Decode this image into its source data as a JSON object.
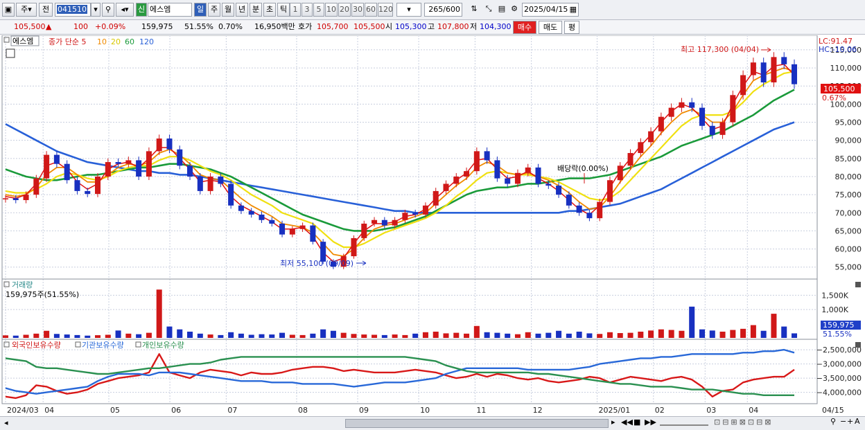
{
  "toolbar": {
    "type_label": "주",
    "prev_label": "전",
    "code": "041510",
    "badge": "신",
    "name": "에스엠",
    "periods": [
      "일",
      "주",
      "월",
      "년",
      "분",
      "초",
      "틱"
    ],
    "active_period": "일",
    "minutes": [
      "1",
      "3",
      "5",
      "10",
      "20",
      "30",
      "60",
      "120"
    ],
    "count": "265",
    "count_total": "/600",
    "date": "2025/04/15"
  },
  "quote": {
    "price": "105,500",
    "change": "100",
    "change_pct": "+0.09%",
    "volume": "159,975",
    "volume_ratio": "51.55%",
    "turnover": "0.70%",
    "amount": "16,950백만",
    "bid_label": "호가",
    "ask_price": "105,700",
    "bid_price": "105,500",
    "open_label": "시",
    "open": "105,300",
    "high_label": "고",
    "high": "107,800",
    "low_label": "저",
    "low": "104,300",
    "buy_button": "매수",
    "sell_button": "매도",
    "eval_button": "평"
  },
  "price_panel": {
    "name_tag": "에스엠",
    "ma_prefix": "종가 단순 5",
    "ma_periods": [
      "10",
      "20",
      "60",
      "120"
    ],
    "lc": "LC:91.47",
    "hc": "HC:-10.06",
    "current_tag": "105,500",
    "current_pct": "0.67%",
    "high_annotation": "최고 117,300 (04/04)",
    "low_annotation": "최저 55,100 (09/09)",
    "dividend_annotation": "배당락(0.00%)"
  },
  "volume_panel": {
    "title": "거래량",
    "info": "159,975주(51.55%)",
    "current_tag": "159,975",
    "current_pct": "51.55%"
  },
  "holdings_panel": {
    "series_labels": [
      "외국인보유수량",
      "기관보유수량",
      "개인보유수량"
    ]
  },
  "colors": {
    "up": "#d01818",
    "down": "#1830c0",
    "ma5": "#e01010",
    "ma10": "#f08a00",
    "ma20": "#f0e010",
    "ma60": "#1a9a3a",
    "ma120": "#2860d8",
    "foreign": "#d81818",
    "institution": "#2868d8",
    "individual": "#2a9050",
    "grid": "#c8cede",
    "axis_text": "#222222"
  },
  "chart_data": [
    {
      "type": "candlestick",
      "title": "에스엠",
      "x_axis_labels": [
        "2024/03",
        "04",
        "05",
        "06",
        "07",
        "08",
        "09",
        "10",
        "11",
        "12",
        "2025/01",
        "02",
        "03",
        "04",
        "04/15"
      ],
      "y_ticks": [
        55000,
        60000,
        65000,
        70000,
        75000,
        80000,
        85000,
        90000,
        95000,
        100000,
        105000,
        110000,
        115000
      ],
      "ylim": [
        51700,
        119000
      ],
      "series": [
        {
          "name": "종가",
          "values": [
            74000,
            73500,
            75000,
            79500,
            86000,
            83500,
            79000,
            76000,
            75200,
            80000,
            84000,
            83500,
            84500,
            80000,
            87000,
            90500,
            87500,
            83000,
            80000,
            76000,
            80000,
            78000,
            72000,
            70500,
            69500,
            68000,
            67000,
            64000,
            65500,
            66500,
            62000,
            56500,
            55100,
            58000,
            63000,
            67000,
            68000,
            66500,
            68000,
            70000,
            69500,
            72000,
            76000,
            78000,
            80000,
            81500,
            87000,
            84500,
            79500,
            78000,
            81000,
            82500,
            78000,
            77500,
            75000,
            72000,
            70000,
            68500,
            73000,
            79000,
            83000,
            86500,
            89500,
            92500,
            96500,
            99000,
            100500,
            99000,
            94000,
            91500,
            95000,
            102500,
            108000,
            111500,
            106000,
            113000,
            111000,
            105500
          ]
        },
        {
          "name": "5",
          "values": [
            74500,
            74000,
            75000,
            78000,
            83000,
            84000,
            82000,
            78500,
            76500,
            78000,
            82000,
            83500,
            84000,
            82500,
            85000,
            88000,
            88000,
            85000,
            82000,
            78500,
            79000,
            78500,
            74500,
            72000,
            70500,
            69000,
            67500,
            65500,
            65500,
            66000,
            63500,
            59000,
            56500,
            57500,
            61500,
            65000,
            67000,
            67000,
            67500,
            69000,
            69500,
            71000,
            74000,
            76500,
            79000,
            81000,
            84500,
            85000,
            82000,
            79500,
            80000,
            81500,
            79500,
            78000,
            76000,
            73500,
            71000,
            69500,
            72000,
            77000,
            81500,
            85000,
            88500,
            91500,
            95000,
            98000,
            100000,
            99000,
            96000,
            93000,
            94000,
            100000,
            105000,
            109000,
            108000,
            110500,
            111000,
            108000
          ]
        },
        {
          "name": "10",
          "values": [
            75000,
            74500,
            75000,
            77000,
            80500,
            82500,
            82500,
            80500,
            78500,
            78500,
            80500,
            82500,
            83500,
            83000,
            84000,
            86500,
            87500,
            86000,
            83500,
            80500,
            79500,
            79000,
            76500,
            74000,
            72000,
            70500,
            69000,
            67000,
            66500,
            66000,
            64500,
            61500,
            58500,
            58000,
            60000,
            63000,
            65500,
            66500,
            67000,
            68000,
            69000,
            70000,
            72500,
            75000,
            77500,
            79500,
            82500,
            84000,
            83000,
            81000,
            80500,
            81000,
            80000,
            79000,
            77500,
            75500,
            73000,
            71000,
            71500,
            74500,
            78500,
            82000,
            85500,
            88500,
            92000,
            95000,
            97500,
            98500,
            97000,
            95000,
            95000,
            98000,
            102500,
            106500,
            108000,
            109000,
            110000,
            109000
          ]
        },
        {
          "name": "20",
          "values": [
            76000,
            75500,
            75500,
            76500,
            78000,
            80000,
            81000,
            80500,
            79500,
            79000,
            80000,
            81500,
            82500,
            83000,
            83000,
            84500,
            85500,
            85500,
            84500,
            83000,
            81500,
            80500,
            79000,
            77000,
            75000,
            73500,
            72000,
            70000,
            69000,
            68000,
            67000,
            64500,
            62000,
            60500,
            60500,
            61500,
            63000,
            64500,
            65500,
            66500,
            67500,
            68500,
            70000,
            72000,
            74500,
            76500,
            79000,
            81000,
            81500,
            81000,
            80500,
            80500,
            80000,
            79500,
            78500,
            77000,
            75500,
            74000,
            73500,
            74000,
            76000,
            79000,
            82000,
            85000,
            88000,
            91000,
            94000,
            96000,
            97000,
            97000,
            97000,
            98000,
            100500,
            103500,
            105500,
            107000,
            108500,
            109000
          ]
        },
        {
          "name": "60",
          "values": [
            82000,
            81000,
            80000,
            79500,
            79000,
            79000,
            79500,
            80000,
            80500,
            80500,
            81000,
            81500,
            82000,
            82500,
            82500,
            83000,
            83500,
            83500,
            83000,
            82500,
            82000,
            81000,
            80000,
            78500,
            77000,
            75500,
            74000,
            72500,
            71000,
            69500,
            68500,
            67500,
            66500,
            65500,
            65000,
            65000,
            65000,
            65500,
            66000,
            67000,
            68000,
            69000,
            70500,
            72000,
            73500,
            75000,
            76000,
            76500,
            77000,
            77000,
            77500,
            78000,
            78000,
            78500,
            79000,
            79500,
            79500,
            79500,
            80000,
            80500,
            81500,
            82500,
            83500,
            84500,
            85500,
            87000,
            88500,
            89500,
            90500,
            91500,
            92500,
            94000,
            95500,
            97000,
            99000,
            101000,
            102500,
            104000
          ]
        },
        {
          "name": "120",
          "values": [
            94500,
            93000,
            91500,
            90000,
            88500,
            87000,
            86000,
            85000,
            84000,
            83500,
            83000,
            82500,
            82000,
            81500,
            81500,
            81000,
            81000,
            80500,
            80500,
            80000,
            79500,
            79000,
            78500,
            78000,
            77500,
            77000,
            76500,
            76000,
            75500,
            75000,
            74500,
            74000,
            73500,
            73000,
            72500,
            72000,
            71500,
            71000,
            70500,
            70500,
            70000,
            70000,
            70000,
            70000,
            70000,
            70000,
            70000,
            70000,
            70000,
            70000,
            70000,
            70000,
            70000,
            70000,
            70000,
            70500,
            70500,
            71000,
            71500,
            72000,
            72500,
            73500,
            74500,
            75500,
            76500,
            78000,
            79500,
            81000,
            82500,
            84000,
            85500,
            87000,
            88500,
            90000,
            91500,
            93000,
            94000,
            95000
          ]
        }
      ],
      "annotations": [
        {
          "text": "최고 117,300 (04/04)",
          "value": 117300
        },
        {
          "text": "최저 55,100 (09/09)",
          "value": 55100
        },
        {
          "text": "배당락(0.00%)"
        }
      ]
    },
    {
      "type": "bar",
      "title": "거래량",
      "y_ticks": [
        1000000,
        1500000
      ],
      "ylim": [
        0,
        1900000
      ],
      "values": [
        90000,
        80000,
        110000,
        150000,
        250000,
        140000,
        120000,
        100000,
        80000,
        95000,
        110000,
        260000,
        150000,
        130000,
        180000,
        1700000,
        400000,
        300000,
        220000,
        150000,
        120000,
        100000,
        200000,
        150000,
        110000,
        130000,
        120000,
        180000,
        110000,
        100000,
        150000,
        300000,
        250000,
        180000,
        140000,
        120000,
        110000,
        100000,
        120000,
        100000,
        150000,
        200000,
        220000,
        160000,
        180000,
        150000,
        420000,
        200000,
        180000,
        150000,
        130000,
        200000,
        150000,
        180000,
        250000,
        150000,
        220000,
        160000,
        140000,
        200000,
        170000,
        180000,
        220000,
        260000,
        300000,
        280000,
        250000,
        1100000,
        300000,
        260000,
        220000,
        280000,
        320000,
        450000,
        250000,
        850000,
        400000,
        160000
      ]
    },
    {
      "type": "line",
      "title": "외국인보유수량 · 기관보유수량 · 개인보유수량",
      "y_ticks": [
        -4000000,
        -3500000,
        -3000000,
        -2500000
      ],
      "ylim": [
        -4350000,
        -2350000
      ],
      "series": [
        {
          "name": "외국인보유수량",
          "values": [
            -4150000,
            -4200000,
            -4100000,
            -3750000,
            -3800000,
            -3950000,
            -4050000,
            -4000000,
            -3900000,
            -3700000,
            -3600000,
            -3500000,
            -3450000,
            -3400000,
            -3300000,
            -2650000,
            -3300000,
            -3400000,
            -3500000,
            -3300000,
            -3200000,
            -3250000,
            -3300000,
            -3400000,
            -3300000,
            -3350000,
            -3350000,
            -3300000,
            -3200000,
            -3150000,
            -3100000,
            -3100000,
            -3150000,
            -3250000,
            -3200000,
            -3250000,
            -3300000,
            -3300000,
            -3300000,
            -3250000,
            -3200000,
            -3250000,
            -3300000,
            -3400000,
            -3500000,
            -3450000,
            -3350000,
            -3450000,
            -3350000,
            -3400000,
            -3500000,
            -3550000,
            -3500000,
            -3600000,
            -3650000,
            -3600000,
            -3550000,
            -3450000,
            -3500000,
            -3650000,
            -3550000,
            -3450000,
            -3500000,
            -3550000,
            -3600000,
            -3500000,
            -3450000,
            -3550000,
            -3800000,
            -4150000,
            -3950000,
            -3900000,
            -3650000,
            -3550000,
            -3500000,
            -3450000,
            -3450000,
            -3200000
          ]
        },
        {
          "name": "기관보유수량",
          "values": [
            -3850000,
            -3950000,
            -4000000,
            -4050000,
            -4000000,
            -3950000,
            -3900000,
            -3850000,
            -3800000,
            -3600000,
            -3450000,
            -3350000,
            -3350000,
            -3350000,
            -3400000,
            -3300000,
            -3300000,
            -3300000,
            -3350000,
            -3400000,
            -3450000,
            -3500000,
            -3550000,
            -3600000,
            -3600000,
            -3600000,
            -3650000,
            -3650000,
            -3650000,
            -3700000,
            -3700000,
            -3700000,
            -3700000,
            -3750000,
            -3800000,
            -3750000,
            -3700000,
            -3650000,
            -3650000,
            -3650000,
            -3600000,
            -3550000,
            -3500000,
            -3350000,
            -3250000,
            -3150000,
            -3150000,
            -3150000,
            -3150000,
            -3150000,
            -3150000,
            -3200000,
            -3200000,
            -3200000,
            -3200000,
            -3200000,
            -3150000,
            -3100000,
            -3000000,
            -2950000,
            -2900000,
            -2850000,
            -2800000,
            -2800000,
            -2750000,
            -2750000,
            -2700000,
            -2650000,
            -2650000,
            -2650000,
            -2650000,
            -2650000,
            -2600000,
            -2600000,
            -2550000,
            -2550000,
            -2500000,
            -2600000
          ]
        },
        {
          "name": "개인보유수량",
          "values": [
            -2800000,
            -2850000,
            -2900000,
            -3100000,
            -3150000,
            -3150000,
            -3200000,
            -3250000,
            -3300000,
            -3350000,
            -3350000,
            -3300000,
            -3250000,
            -3200000,
            -3150000,
            -3150000,
            -3100000,
            -3050000,
            -3000000,
            -3000000,
            -2950000,
            -2850000,
            -2800000,
            -2750000,
            -2750000,
            -2750000,
            -2750000,
            -2750000,
            -2750000,
            -2750000,
            -2750000,
            -2750000,
            -2750000,
            -2750000,
            -2750000,
            -2750000,
            -2750000,
            -2750000,
            -2750000,
            -2750000,
            -2800000,
            -2850000,
            -2900000,
            -3050000,
            -3150000,
            -3250000,
            -3300000,
            -3300000,
            -3300000,
            -3300000,
            -3300000,
            -3300000,
            -3350000,
            -3350000,
            -3400000,
            -3450000,
            -3500000,
            -3550000,
            -3600000,
            -3650000,
            -3700000,
            -3700000,
            -3750000,
            -3800000,
            -3800000,
            -3800000,
            -3850000,
            -3900000,
            -3900000,
            -3900000,
            -3950000,
            -4000000,
            -4050000,
            -4050000,
            -4100000,
            -4100000,
            -4100000,
            -4100000
          ]
        }
      ]
    }
  ]
}
